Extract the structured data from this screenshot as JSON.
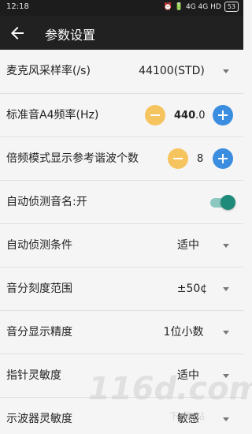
{
  "status_bar": {
    "time": "12:18",
    "icons_text": "⏰ 🔋 4G 4G HD",
    "battery": "53"
  },
  "app_bar": {
    "title": "参数设置",
    "back_icon": "arrow-left-icon"
  },
  "settings": [
    {
      "label": "麦克风采样率(/s)",
      "value": "44100(STD)",
      "control": "dropdown"
    },
    {
      "label": "标准音A4频率(Hz)",
      "value_main": "440",
      "value_decimal": ".0",
      "control": "stepper"
    },
    {
      "label": "倍频模式显示参考谐波个数",
      "value": "8",
      "control": "stepper"
    },
    {
      "label": "自动侦测音名:开",
      "value": "on",
      "control": "toggle"
    },
    {
      "label": "自动侦测条件",
      "value": "适中",
      "control": "dropdown"
    },
    {
      "label": "音分刻度范围",
      "value": "±50¢",
      "control": "dropdown"
    },
    {
      "label": "音分显示精度",
      "value": "1位小数",
      "control": "dropdown"
    },
    {
      "label": "指针灵敏度",
      "value": "适中",
      "control": "dropdown"
    },
    {
      "label": "示波器灵敏度",
      "value": "敏感",
      "control": "dropdown"
    }
  ],
  "watermark": {
    "main": "116d.com",
    "sub": "下载站"
  },
  "colors": {
    "minus": "#f6c45e",
    "plus": "#3b8de0",
    "toggle": "#1e8a7a",
    "appbar": "#212121"
  }
}
